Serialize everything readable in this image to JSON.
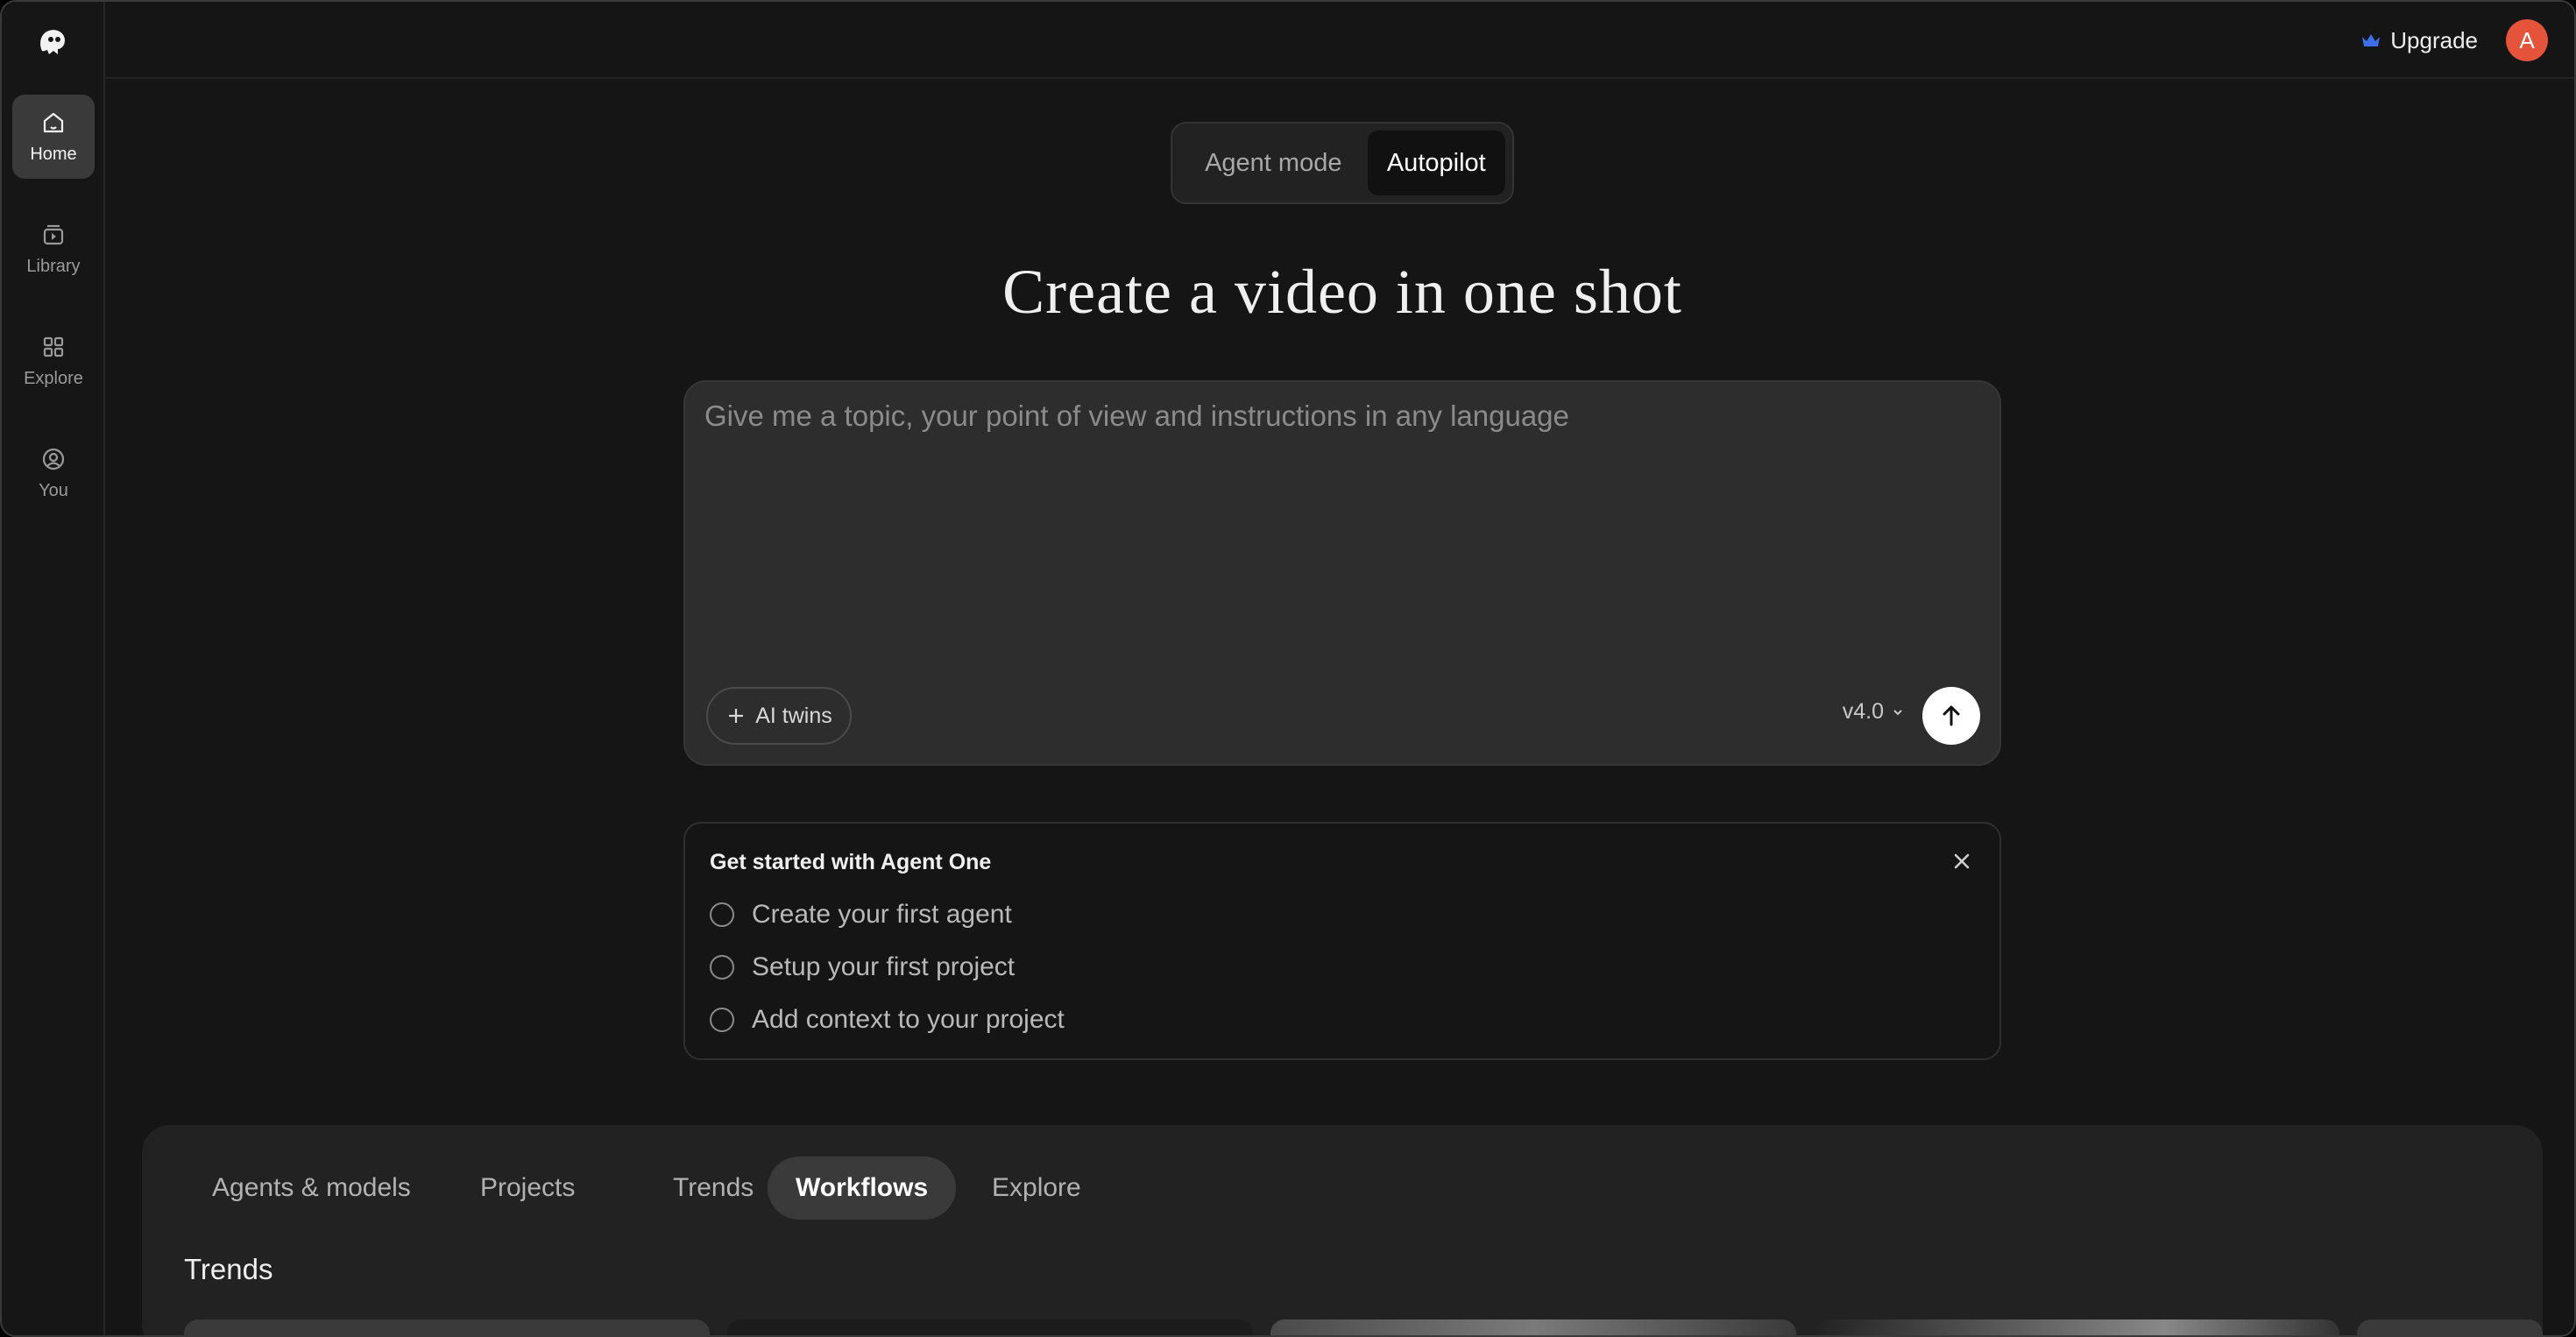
{
  "sidebar": {
    "items": [
      {
        "label": "Home",
        "icon": "home-icon",
        "active": true
      },
      {
        "label": "Library",
        "icon": "library-icon"
      },
      {
        "label": "Explore",
        "icon": "grid-icon"
      },
      {
        "label": "You",
        "icon": "user-icon"
      }
    ]
  },
  "topbar": {
    "upgrade_label": "Upgrade",
    "avatar_initial": "A",
    "avatar_color": "#e5533a",
    "crown_color": "#3b6ee8"
  },
  "mode_toggle": {
    "agent_label": "Agent mode",
    "autopilot_label": "Autopilot",
    "selected": "Autopilot"
  },
  "headline": "Create a video in one shot",
  "prompt": {
    "placeholder": "Give me a topic, your point of view and instructions in any language",
    "value": "",
    "ai_twins_label": "AI twins",
    "version": "v4.0"
  },
  "get_started": {
    "title": "Get started with Agent One",
    "items": [
      "Create your first agent",
      "Setup your first project",
      "Add context to your project"
    ]
  },
  "bottom": {
    "tabs": [
      {
        "label": "Agents & models"
      },
      {
        "label": "Projects"
      },
      {
        "label": "Trends"
      },
      {
        "label": "Workflows",
        "active": true
      },
      {
        "label": "Explore"
      }
    ],
    "section_title": "Trends"
  }
}
